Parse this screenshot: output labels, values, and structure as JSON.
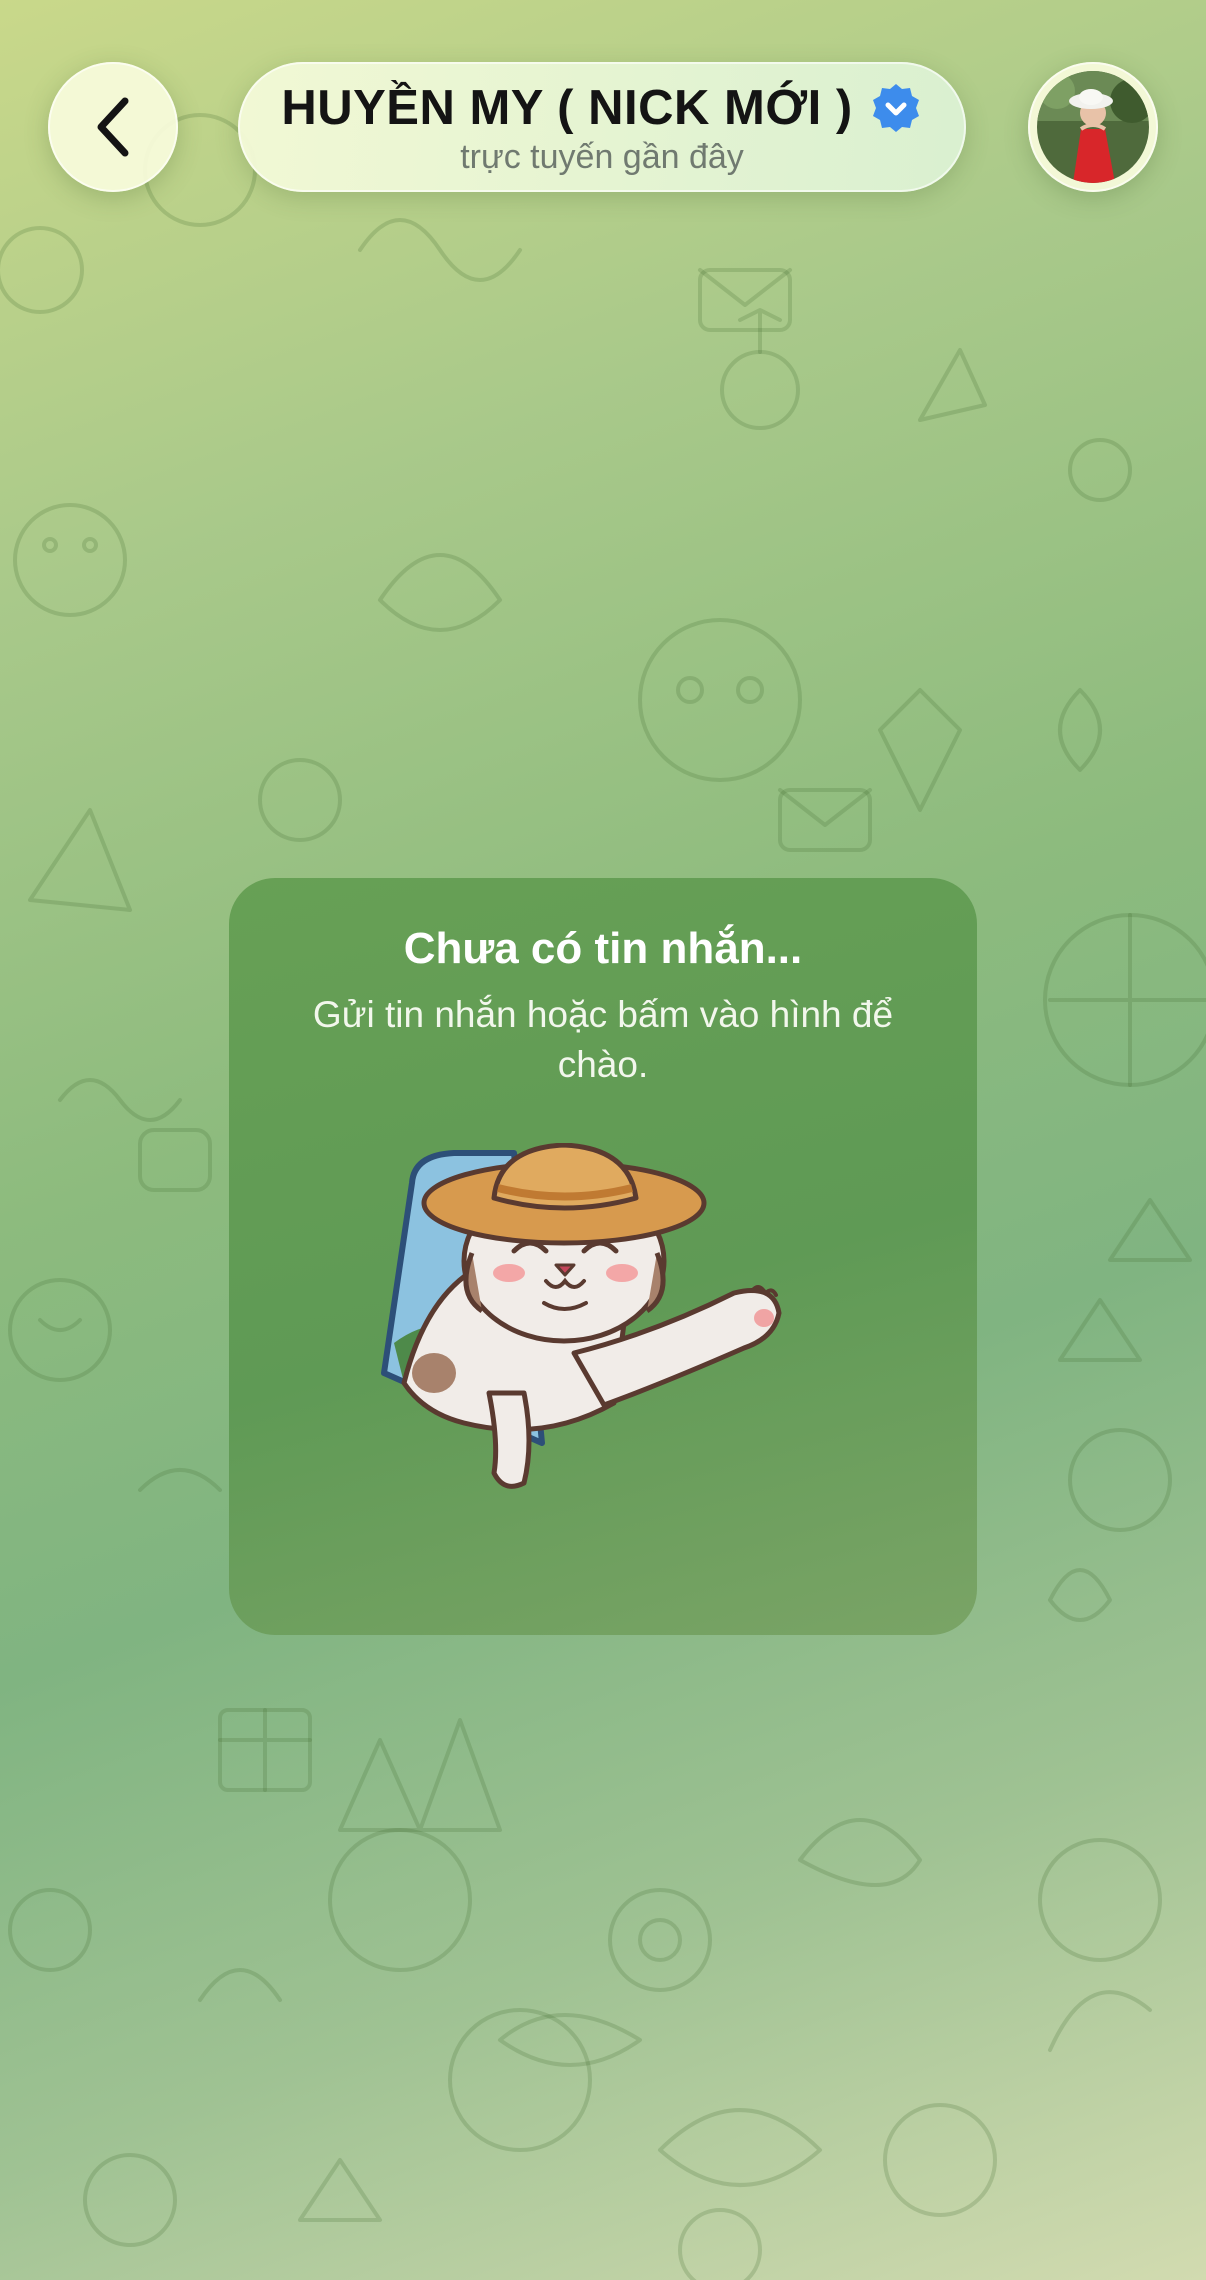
{
  "header": {
    "back_icon": "chevron-left-icon",
    "contact_name": "HUYỀN MY ( NICK MỚI )",
    "verified_icon": "verified-badge-icon",
    "status": "trực tuyến gần đây",
    "avatar": "contact-avatar"
  },
  "empty_state": {
    "title": "Chưa có tin nhắn...",
    "subtitle": "Gửi tin nhắn hoặc bấm vào hình để chào.",
    "sticker": "waving-cat-sticker"
  },
  "colors": {
    "accent_blue": "#3d8cec",
    "card_green": "#65a056",
    "header_glass": "#f4fad8"
  }
}
